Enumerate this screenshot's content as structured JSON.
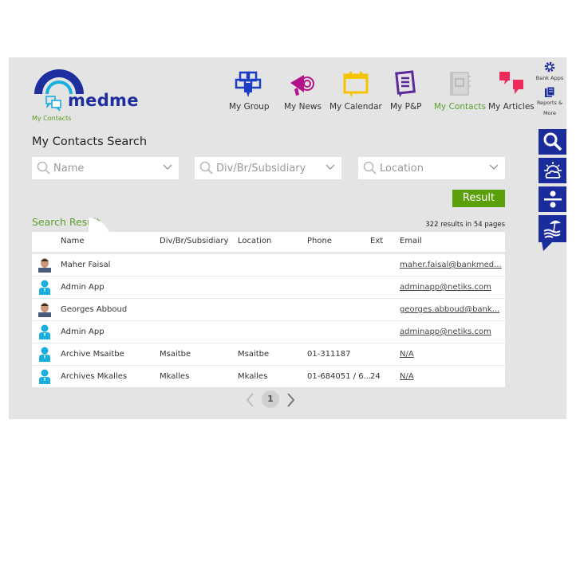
{
  "app": {
    "logo_text": "medme",
    "breadcrumb": "My Contacts"
  },
  "nav": [
    {
      "label": "My Group",
      "icon": "group-icon",
      "color": "#1a3fc4",
      "active": false
    },
    {
      "label": "My News",
      "icon": "megaphone-icon",
      "color": "#b3128a",
      "active": false
    },
    {
      "label": "My Calendar",
      "icon": "calendar-icon",
      "color": "#f6c400",
      "active": false
    },
    {
      "label": "My P&P",
      "icon": "document-icon",
      "color": "#5b2a9a",
      "active": false
    },
    {
      "label": "My Contacts",
      "icon": "contacts-book-icon",
      "color": "#bdbdbd",
      "active": true
    },
    {
      "label": "My Articles",
      "icon": "speech-bubbles-icon",
      "color": "#f02a5a",
      "active": false
    }
  ],
  "side_top": {
    "bank_apps": "Bank Apps",
    "reports": "Reports &",
    "reports_more": "More"
  },
  "side_buttons": [
    "search-icon",
    "weather-icon",
    "divide-icon",
    "beach-icon"
  ],
  "search": {
    "title": "My Contacts Search",
    "fields": [
      {
        "placeholder": "Name"
      },
      {
        "placeholder": "Div/Br/Subsidiary"
      },
      {
        "placeholder": "Location"
      }
    ],
    "result_button": "Result"
  },
  "results": {
    "label": "Search Result",
    "count_text": "322 results in 54 pages",
    "columns": [
      "Name",
      "Div/Br/Subsidiary",
      "Location",
      "Phone",
      "Ext",
      "Email"
    ],
    "rows": [
      {
        "avatar": "photo",
        "name": "Maher Faisal",
        "div": "",
        "location": "",
        "phone": "",
        "ext": "",
        "email": "maher.faisal@bankmed..."
      },
      {
        "avatar": "generic",
        "name": "Admin App",
        "div": "",
        "location": "",
        "phone": "",
        "ext": "",
        "email": "adminapp@netiks.com"
      },
      {
        "avatar": "photo",
        "name": "Georges Abboud",
        "div": "",
        "location": "",
        "phone": "",
        "ext": "",
        "email": "georges.abboud@bank..."
      },
      {
        "avatar": "generic",
        "name": "Admin App",
        "div": "",
        "location": "",
        "phone": "",
        "ext": "",
        "email": "adminapp@netiks.com"
      },
      {
        "avatar": "generic",
        "name": "Archive Msaitbe",
        "div": "Msaitbe",
        "location": "Msaitbe",
        "phone": "01-311187",
        "ext": "",
        "email": "N/A"
      },
      {
        "avatar": "generic",
        "name": "Archives Mkalles",
        "div": "Mkalles",
        "location": "Mkalles",
        "phone": "01-684051 / 6...",
        "ext": "24",
        "email": "N/A"
      }
    ]
  },
  "pager": {
    "current_page": "1"
  },
  "colors": {
    "accent_green": "#5aa00a",
    "brand_blue": "#1a2b9c",
    "bg": "#e4e4e4"
  }
}
